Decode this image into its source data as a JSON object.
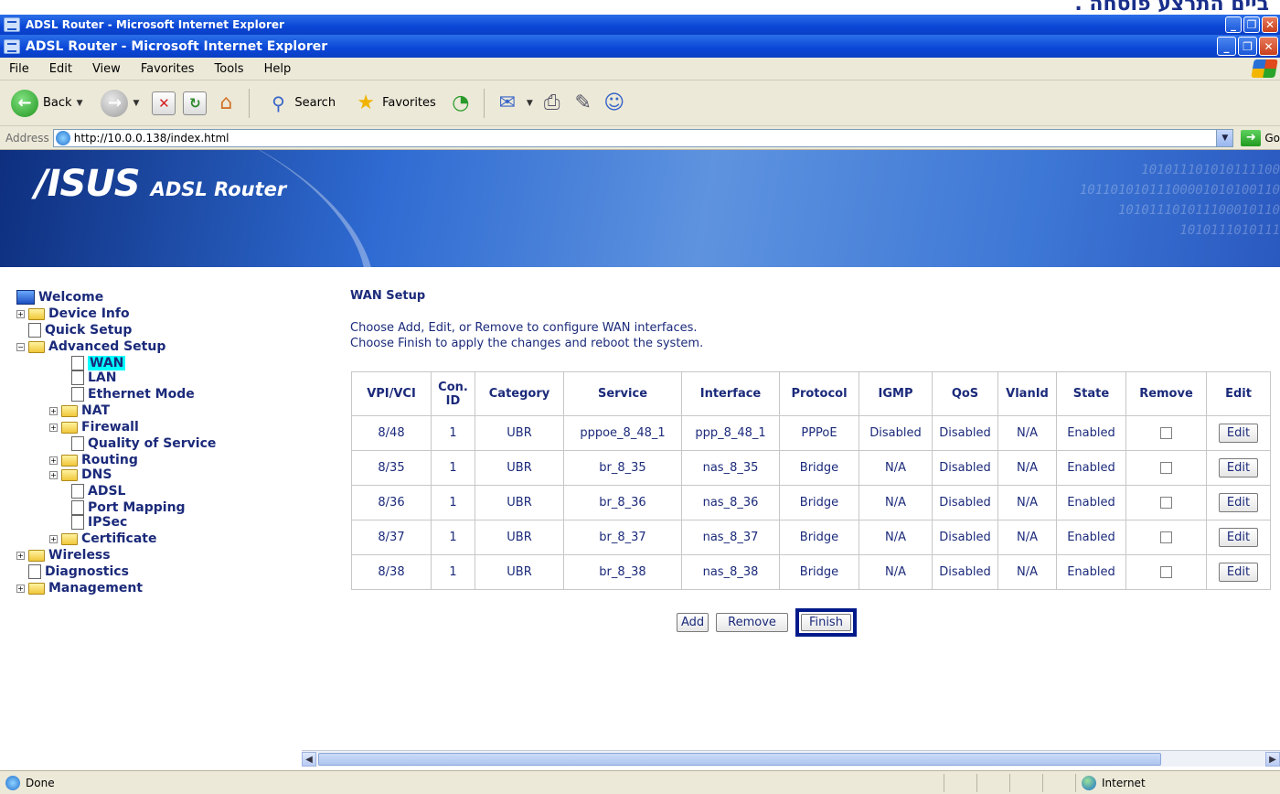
{
  "caption": "ביים התרצע פוסחה .",
  "window": {
    "outer_title": "ADSL Router - Microsoft Internet Explorer",
    "inner_title": "ADSL Router - Microsoft Internet Explorer"
  },
  "menu": [
    "File",
    "Edit",
    "View",
    "Favorites",
    "Tools",
    "Help"
  ],
  "toolbar": {
    "back": "Back",
    "search": "Search",
    "favorites": "Favorites"
  },
  "address": {
    "label": "Address",
    "url": "http://10.0.0.138/index.html",
    "go": "Go"
  },
  "banner": {
    "brand": "/ISUS",
    "product": "ADSL Router",
    "binary": [
      "101011101010111100",
      "10110101011100001010100110",
      "101011101011100010110",
      "1010111010111"
    ]
  },
  "tree": [
    {
      "label": "Welcome",
      "type": "computer",
      "level": 0
    },
    {
      "label": "Device Info",
      "type": "folder",
      "level": 1,
      "expander": "+"
    },
    {
      "label": "Quick Setup",
      "type": "doc",
      "level": 1
    },
    {
      "label": "Advanced Setup",
      "type": "folder-open",
      "level": 1,
      "expander": "-"
    },
    {
      "label": "WAN",
      "type": "doc",
      "level": 2,
      "selected": true
    },
    {
      "label": "LAN",
      "type": "doc",
      "level": 2
    },
    {
      "label": "Ethernet Mode",
      "type": "doc",
      "level": 2
    },
    {
      "label": "NAT",
      "type": "folder",
      "level": 2,
      "expander": "+"
    },
    {
      "label": "Firewall",
      "type": "folder",
      "level": 2,
      "expander": "+"
    },
    {
      "label": "Quality of Service",
      "type": "doc",
      "level": 2
    },
    {
      "label": "Routing",
      "type": "folder",
      "level": 2,
      "expander": "+"
    },
    {
      "label": "DNS",
      "type": "folder",
      "level": 2,
      "expander": "+"
    },
    {
      "label": "ADSL",
      "type": "doc",
      "level": 2
    },
    {
      "label": "Port Mapping",
      "type": "doc",
      "level": 2
    },
    {
      "label": "IPSec",
      "type": "doc",
      "level": 2
    },
    {
      "label": "Certificate",
      "type": "folder",
      "level": 2,
      "expander": "+"
    },
    {
      "label": "Wireless",
      "type": "folder",
      "level": 1,
      "expander": "+"
    },
    {
      "label": "Diagnostics",
      "type": "doc",
      "level": 1
    },
    {
      "label": "Management",
      "type": "folder",
      "level": 1,
      "expander": "+"
    }
  ],
  "wan": {
    "title": "WAN Setup",
    "desc1": "Choose Add, Edit, or Remove to configure WAN interfaces.",
    "desc2": "Choose Finish to apply the changes and reboot the system.",
    "headers": [
      "VPI/VCI",
      "Con. ID",
      "Category",
      "Service",
      "Interface",
      "Protocol",
      "IGMP",
      "QoS",
      "VlanId",
      "State",
      "Remove",
      "Edit"
    ],
    "rows": [
      [
        "8/48",
        "1",
        "UBR",
        "pppoe_8_48_1",
        "ppp_8_48_1",
        "PPPoE",
        "Disabled",
        "Disabled",
        "N/A",
        "Enabled",
        "",
        "Edit"
      ],
      [
        "8/35",
        "1",
        "UBR",
        "br_8_35",
        "nas_8_35",
        "Bridge",
        "N/A",
        "Disabled",
        "N/A",
        "Enabled",
        "",
        "Edit"
      ],
      [
        "8/36",
        "1",
        "UBR",
        "br_8_36",
        "nas_8_36",
        "Bridge",
        "N/A",
        "Disabled",
        "N/A",
        "Enabled",
        "",
        "Edit"
      ],
      [
        "8/37",
        "1",
        "UBR",
        "br_8_37",
        "nas_8_37",
        "Bridge",
        "N/A",
        "Disabled",
        "N/A",
        "Enabled",
        "",
        "Edit"
      ],
      [
        "8/38",
        "1",
        "UBR",
        "br_8_38",
        "nas_8_38",
        "Bridge",
        "N/A",
        "Disabled",
        "N/A",
        "Enabled",
        "",
        "Edit"
      ]
    ],
    "add": "Add",
    "remove": "Remove",
    "finish": "Finish"
  },
  "status": {
    "left": "Done",
    "zone": "Internet"
  }
}
